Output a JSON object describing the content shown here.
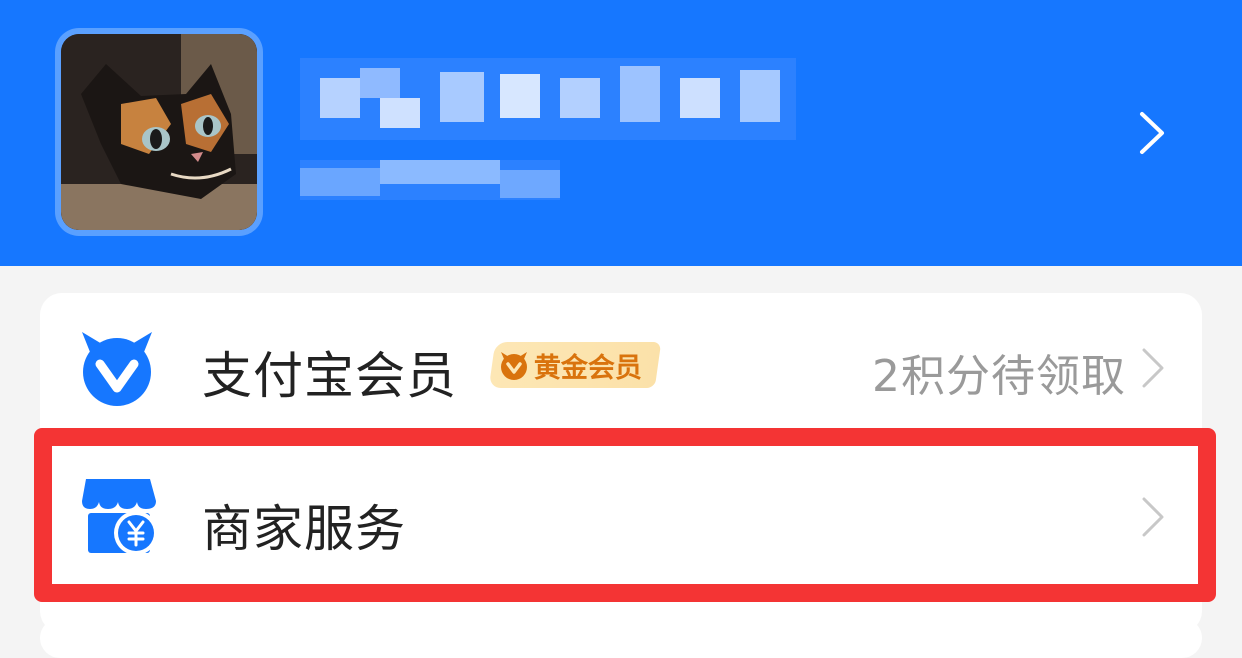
{
  "profile": {
    "avatar_icon": "cat-photo-avatar",
    "name_redacted": true,
    "account_redacted": true,
    "chevron_icon": "chevron-right-icon"
  },
  "menu": {
    "member": {
      "icon": "alipay-member-icon",
      "label": "支付宝会员",
      "badge": "黄金会员",
      "badge_icon": "gold-member-icon",
      "right_text": "2积分待领取"
    },
    "merchant": {
      "icon": "merchant-store-icon",
      "label": "商家服务"
    }
  },
  "colors": {
    "header_bg": "#1677ff",
    "highlight": "#f43434",
    "badge_text": "#d9730d",
    "icon_blue": "#1677ff"
  }
}
